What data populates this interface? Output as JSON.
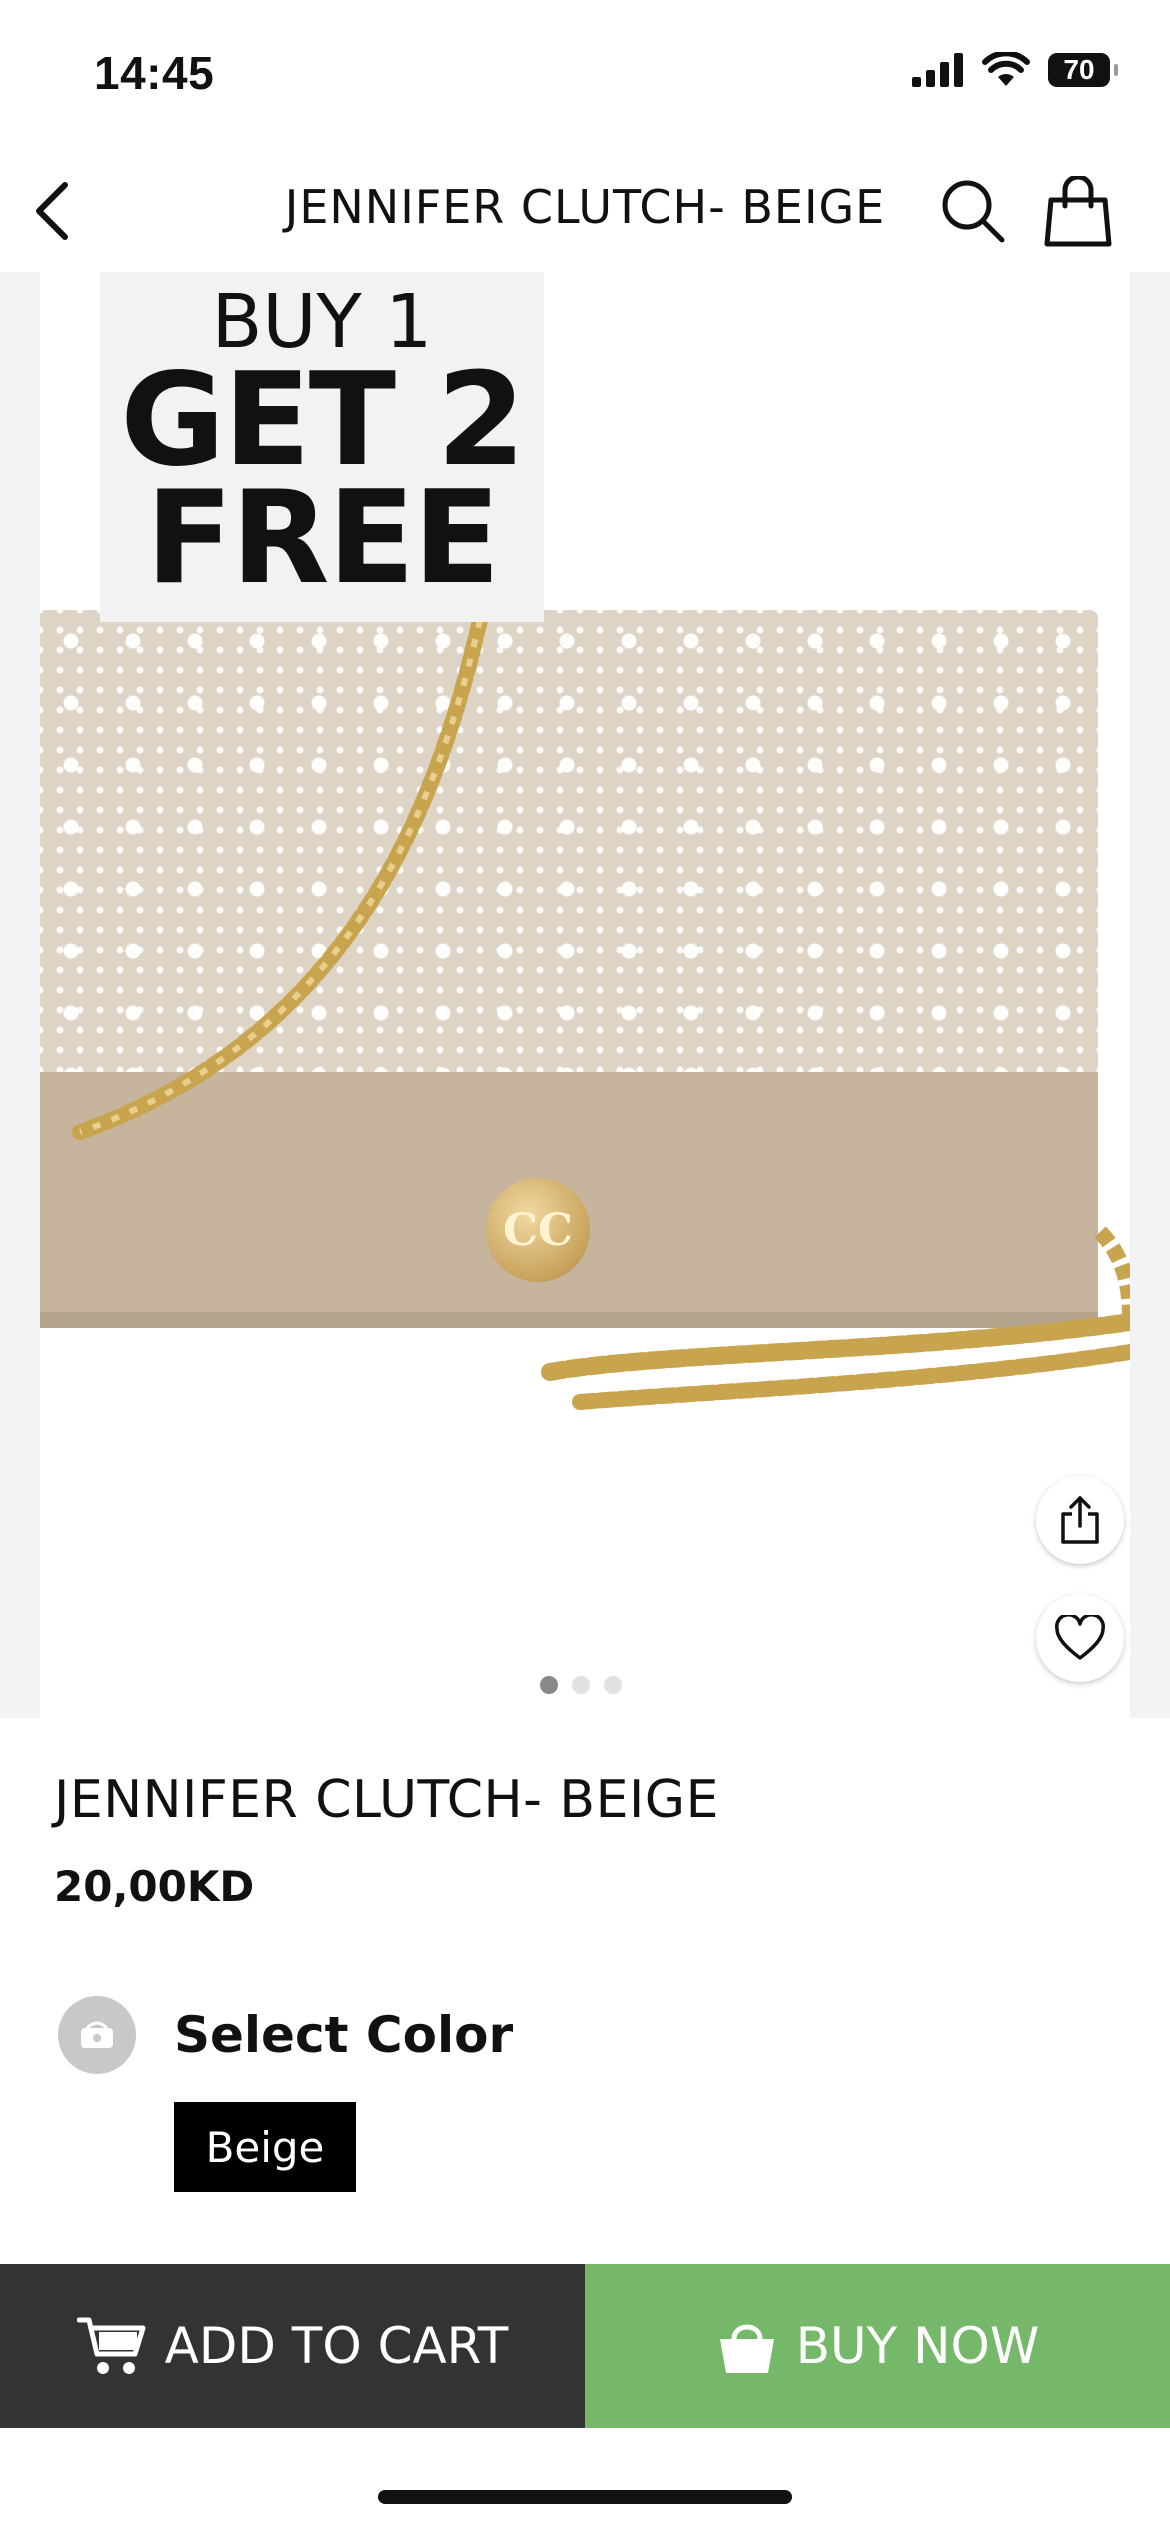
{
  "status_bar": {
    "time": "14:45",
    "battery": "70",
    "icons": [
      "signal-icon",
      "wifi-icon",
      "battery-icon"
    ]
  },
  "header": {
    "title": "JENNIFER CLUTCH- BEIGE",
    "icons": [
      "chevron-left-icon",
      "search-icon",
      "shopping-bag-icon"
    ]
  },
  "gallery": {
    "promo_line1": "BUY 1",
    "promo_line2": "GET 2",
    "promo_line3": "FREE",
    "image_count": 3,
    "active_image": 1,
    "icons": [
      "share-icon",
      "heart-icon"
    ]
  },
  "product": {
    "name": "JENNIFER CLUTCH- BEIGE",
    "price": "20,00KD"
  },
  "color_selector": {
    "label": "Select Color",
    "selected": "Beige"
  },
  "actions": {
    "add_to_cart": "ADD TO CART",
    "buy_now": "BUY NOW"
  },
  "colors": {
    "add_to_cart_bg": "#333333",
    "buy_now_bg": "#76b86a",
    "product_beige": "#c6b49c"
  }
}
